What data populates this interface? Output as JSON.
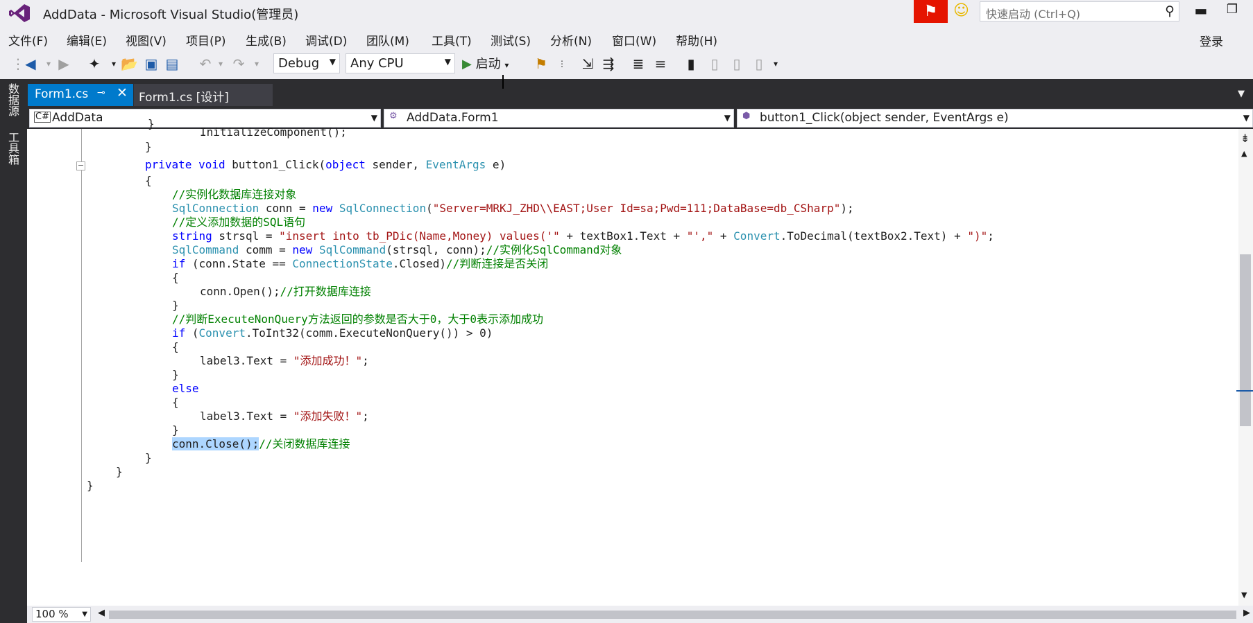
{
  "window": {
    "title": "AddData - Microsoft Visual Studio(管理员)",
    "quick_launch_placeholder": "快速启动 (Ctrl+Q)",
    "sign_in": "登录"
  },
  "menu": [
    "文件(F)",
    "编辑(E)",
    "视图(V)",
    "项目(P)",
    "生成(B)",
    "调试(D)",
    "团队(M)",
    "工具(T)",
    "测试(S)",
    "分析(N)",
    "窗口(W)",
    "帮助(H)"
  ],
  "toolbar": {
    "config": "Debug",
    "platform": "Any CPU",
    "start_label": "启动"
  },
  "side_panels": [
    "数据源",
    "工具箱"
  ],
  "tabs": [
    {
      "label": "Form1.cs",
      "active": true
    },
    {
      "label": "Form1.cs [设计]",
      "active": false
    }
  ],
  "navbar": {
    "project": "AddData",
    "class": "AddData.Form1",
    "member": "button1_Click(object sender, EventArgs e)"
  },
  "code": {
    "l1": "InitializeComponent();",
    "l2": "}",
    "l3_kw1": "private void",
    "l3_a": " button1_Click(",
    "l3_kw2": "object",
    "l3_b": " sender, ",
    "l3_ty": "EventArgs",
    "l3_c": " e)",
    "l4": "{",
    "l5": "//实例化数据库连接对象",
    "l6_ty1": "SqlConnection",
    "l6_a": " conn = ",
    "l6_kw": "new",
    "l6_sp": " ",
    "l6_ty2": "SqlConnection",
    "l6_b": "(",
    "l6_str": "\"Server=MRKJ_ZHD\\\\EAST;User Id=sa;Pwd=111;DataBase=db_CSharp\"",
    "l6_c": ");",
    "l7": "//定义添加数据的SQL语句",
    "l8_kw": "string",
    "l8_a": " strsql = ",
    "l8_str1": "\"insert into tb_PDic(Name,Money) values('\"",
    "l8_b": " + textBox1.Text + ",
    "l8_str2": "\"',\"",
    "l8_c": " + ",
    "l8_ty": "Convert",
    "l8_d": ".ToDecimal(textBox2.Text) + ",
    "l8_str3": "\")\"",
    "l8_e": ";",
    "l9_ty1": "SqlCommand",
    "l9_a": " comm = ",
    "l9_kw": "new",
    "l9_sp": " ",
    "l9_ty2": "SqlCommand",
    "l9_b": "(strsql, conn);",
    "l9_cm": "//实例化SqlCommand对象",
    "l10_kw": "if",
    "l10_a": " (conn.State == ",
    "l10_ty": "ConnectionState",
    "l10_b": ".Closed)",
    "l10_cm": "//判断连接是否关闭",
    "l11": "{",
    "l12_a": "conn.Open();",
    "l12_cm": "//打开数据库连接",
    "l13": "}",
    "l14": "//判断ExecuteNonQuery方法返回的参数是否大于0，大于0表示添加成功",
    "l15_kw": "if",
    "l15_a": " (",
    "l15_ty": "Convert",
    "l15_b": ".ToInt32(comm.ExecuteNonQuery()) > 0)",
    "l16": "{",
    "l17_a": "label3.Text = ",
    "l17_str": "\"添加成功！\"",
    "l17_b": ";",
    "l18": "}",
    "l19": "else",
    "l20": "{",
    "l21_a": "label3.Text = ",
    "l21_str": "\"添加失败！\"",
    "l21_b": ";",
    "l22": "}",
    "l23_sel": "conn.Close();",
    "l23_cm": "//关闭数据库连接",
    "l24": "}",
    "l25": "}",
    "l26": "}"
  },
  "zoom": "100 %",
  "colors": {
    "accent": "#007acc",
    "keyword": "#0000ff",
    "type": "#2b91af",
    "string": "#a31515",
    "comment": "#008000"
  }
}
